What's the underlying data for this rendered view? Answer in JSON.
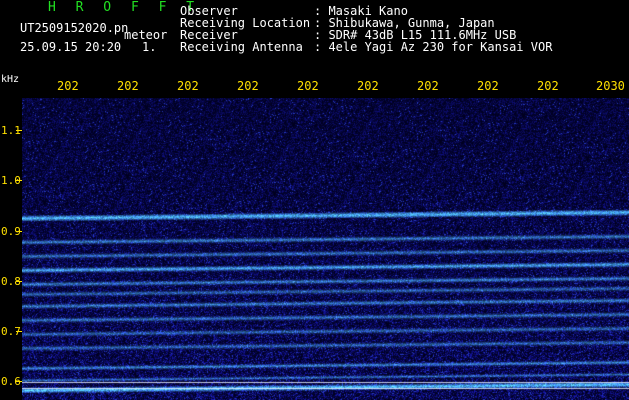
{
  "header": {
    "brand": "H R O F F T",
    "filename": "UT2509152020.pn",
    "type": "meteor",
    "datetime": "25.09.15 20:20",
    "index": "1.",
    "observer_label": "Observer",
    "observer_value": ": Masaki Kano",
    "location_label": "Receiving Location",
    "location_value": ": Shibukawa, Gunma, Japan",
    "receiver_label": "Receiver",
    "receiver_value": ": SDR# 43dB L15 111.6MHz USB",
    "antenna_label": "Receiving Antenna",
    "antenna_value": ": 4ele Yagi Az 230 for Kansai VOR"
  },
  "axis": {
    "unit": "kHz",
    "time_labels": [
      "202",
      "202",
      "202",
      "202",
      "202",
      "202",
      "202",
      "202",
      "202",
      "2030"
    ],
    "freq_labels": [
      "1.1",
      "1.0",
      "0.9",
      "0.8",
      "0.7",
      "0.6"
    ]
  },
  "colors": {
    "background": "#000000",
    "label": "#ffe000",
    "brand": "#22e022",
    "signal": "#6ee6ff",
    "noise": "#1a1acc"
  }
}
